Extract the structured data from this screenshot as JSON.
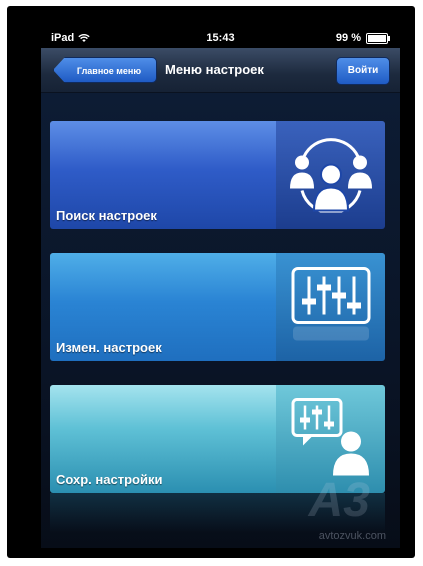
{
  "statusbar": {
    "device": "iPad",
    "time": "15:43",
    "battery": "99 %",
    "battery_level": 0.99
  },
  "navbar": {
    "back_label": "Главное меню",
    "title": "Меню настроек",
    "login_label": "Войти"
  },
  "cards": [
    {
      "label": "Поиск настроек",
      "icon": "users-network-icon"
    },
    {
      "label": "Измен. настроек",
      "icon": "equalizer-sliders-icon"
    },
    {
      "label": "Сохр. настройки",
      "icon": "user-share-settings-icon"
    }
  ],
  "watermark": {
    "logo": "A3",
    "site": "avtozvuk.com"
  },
  "colors": {
    "nav_button": "#2f6fd8",
    "card1": "#2f5cc8",
    "card2": "#2a84d4",
    "card3": "#5fc1d6"
  }
}
